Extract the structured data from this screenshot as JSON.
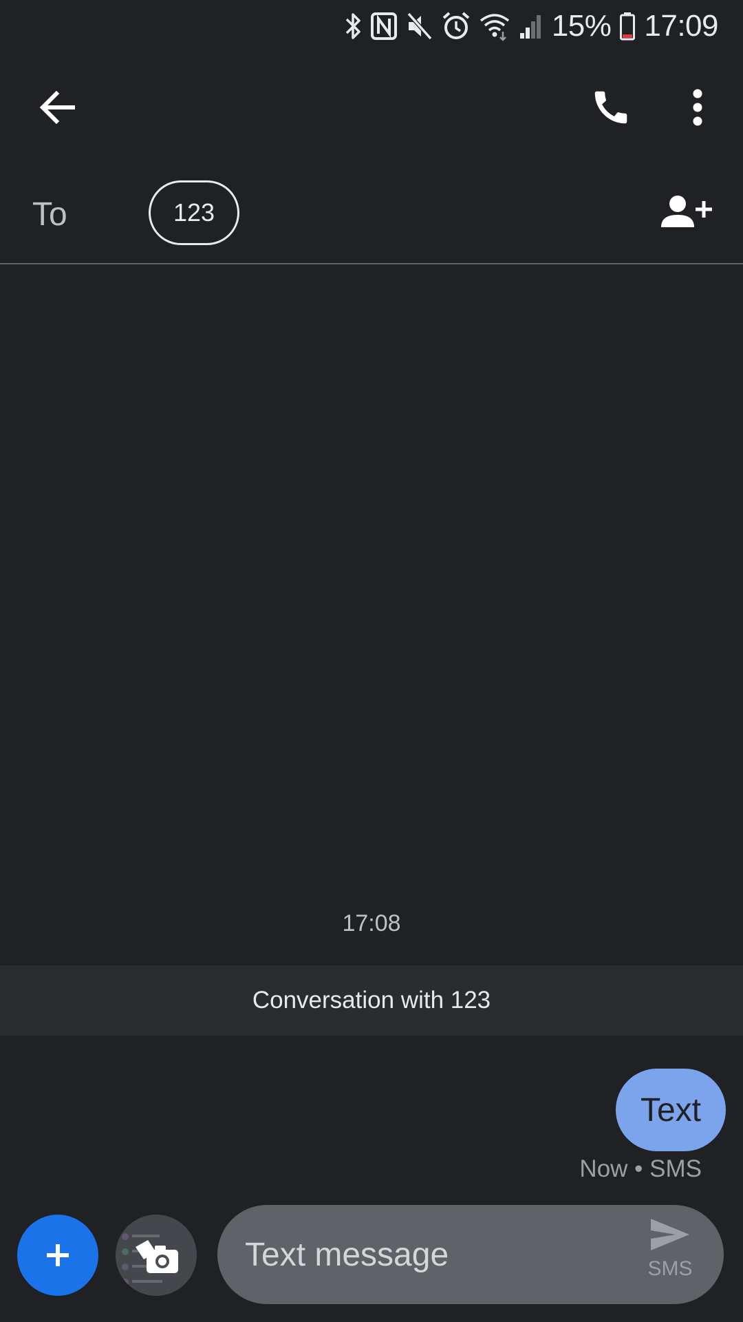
{
  "status_bar": {
    "battery_percent": "15%",
    "time": "17:09",
    "icons": [
      "bluetooth-icon",
      "nfc-icon",
      "mute-icon",
      "alarm-icon",
      "wifi-icon",
      "signal-icon",
      "battery-icon"
    ]
  },
  "app_bar": {
    "icons": [
      "back-arrow-icon",
      "phone-icon",
      "more-vert-icon"
    ]
  },
  "recipient": {
    "to_label": "To",
    "chip_label": "123",
    "add_contact_icon": "add-person-icon"
  },
  "conversation": {
    "timestamp": "17:08",
    "banner_text": "Conversation with 123",
    "messages": [
      {
        "text": "Text",
        "direction": "outgoing",
        "meta": "Now • SMS"
      }
    ]
  },
  "composer": {
    "placeholder": "Text message",
    "value": "",
    "send_label": "SMS",
    "icons": [
      "plus-icon",
      "gallery-camera-icon",
      "send-icon"
    ]
  },
  "colors": {
    "background": "#202124",
    "banner": "#2b2c2f",
    "outgoing_bubble": "#7ba4ec",
    "fab_blue": "#1a73e8",
    "compose_field": "#5f6368"
  }
}
